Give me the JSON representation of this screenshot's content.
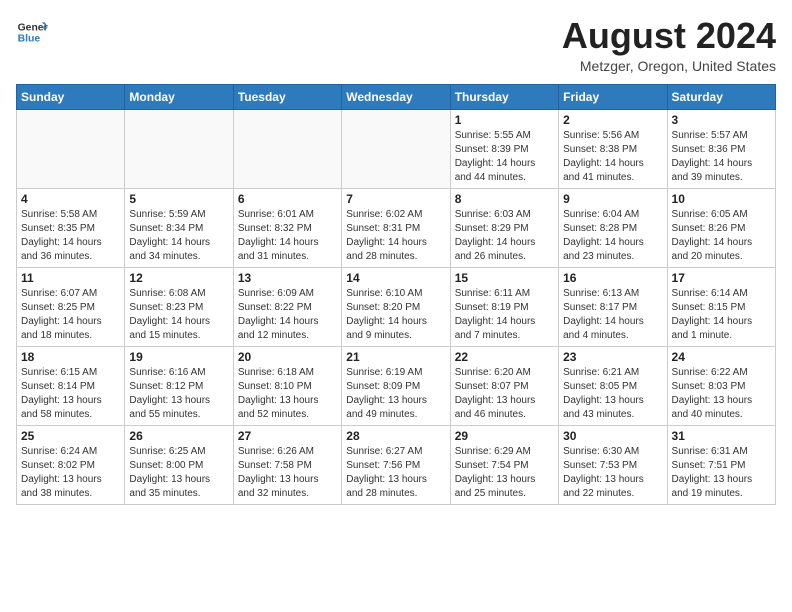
{
  "header": {
    "logo_line1": "General",
    "logo_line2": "Blue",
    "title": "August 2024",
    "subtitle": "Metzger, Oregon, United States"
  },
  "weekdays": [
    "Sunday",
    "Monday",
    "Tuesday",
    "Wednesday",
    "Thursday",
    "Friday",
    "Saturday"
  ],
  "weeks": [
    [
      {
        "day": "",
        "info": ""
      },
      {
        "day": "",
        "info": ""
      },
      {
        "day": "",
        "info": ""
      },
      {
        "day": "",
        "info": ""
      },
      {
        "day": "1",
        "info": "Sunrise: 5:55 AM\nSunset: 8:39 PM\nDaylight: 14 hours\nand 44 minutes."
      },
      {
        "day": "2",
        "info": "Sunrise: 5:56 AM\nSunset: 8:38 PM\nDaylight: 14 hours\nand 41 minutes."
      },
      {
        "day": "3",
        "info": "Sunrise: 5:57 AM\nSunset: 8:36 PM\nDaylight: 14 hours\nand 39 minutes."
      }
    ],
    [
      {
        "day": "4",
        "info": "Sunrise: 5:58 AM\nSunset: 8:35 PM\nDaylight: 14 hours\nand 36 minutes."
      },
      {
        "day": "5",
        "info": "Sunrise: 5:59 AM\nSunset: 8:34 PM\nDaylight: 14 hours\nand 34 minutes."
      },
      {
        "day": "6",
        "info": "Sunrise: 6:01 AM\nSunset: 8:32 PM\nDaylight: 14 hours\nand 31 minutes."
      },
      {
        "day": "7",
        "info": "Sunrise: 6:02 AM\nSunset: 8:31 PM\nDaylight: 14 hours\nand 28 minutes."
      },
      {
        "day": "8",
        "info": "Sunrise: 6:03 AM\nSunset: 8:29 PM\nDaylight: 14 hours\nand 26 minutes."
      },
      {
        "day": "9",
        "info": "Sunrise: 6:04 AM\nSunset: 8:28 PM\nDaylight: 14 hours\nand 23 minutes."
      },
      {
        "day": "10",
        "info": "Sunrise: 6:05 AM\nSunset: 8:26 PM\nDaylight: 14 hours\nand 20 minutes."
      }
    ],
    [
      {
        "day": "11",
        "info": "Sunrise: 6:07 AM\nSunset: 8:25 PM\nDaylight: 14 hours\nand 18 minutes."
      },
      {
        "day": "12",
        "info": "Sunrise: 6:08 AM\nSunset: 8:23 PM\nDaylight: 14 hours\nand 15 minutes."
      },
      {
        "day": "13",
        "info": "Sunrise: 6:09 AM\nSunset: 8:22 PM\nDaylight: 14 hours\nand 12 minutes."
      },
      {
        "day": "14",
        "info": "Sunrise: 6:10 AM\nSunset: 8:20 PM\nDaylight: 14 hours\nand 9 minutes."
      },
      {
        "day": "15",
        "info": "Sunrise: 6:11 AM\nSunset: 8:19 PM\nDaylight: 14 hours\nand 7 minutes."
      },
      {
        "day": "16",
        "info": "Sunrise: 6:13 AM\nSunset: 8:17 PM\nDaylight: 14 hours\nand 4 minutes."
      },
      {
        "day": "17",
        "info": "Sunrise: 6:14 AM\nSunset: 8:15 PM\nDaylight: 14 hours\nand 1 minute."
      }
    ],
    [
      {
        "day": "18",
        "info": "Sunrise: 6:15 AM\nSunset: 8:14 PM\nDaylight: 13 hours\nand 58 minutes."
      },
      {
        "day": "19",
        "info": "Sunrise: 6:16 AM\nSunset: 8:12 PM\nDaylight: 13 hours\nand 55 minutes."
      },
      {
        "day": "20",
        "info": "Sunrise: 6:18 AM\nSunset: 8:10 PM\nDaylight: 13 hours\nand 52 minutes."
      },
      {
        "day": "21",
        "info": "Sunrise: 6:19 AM\nSunset: 8:09 PM\nDaylight: 13 hours\nand 49 minutes."
      },
      {
        "day": "22",
        "info": "Sunrise: 6:20 AM\nSunset: 8:07 PM\nDaylight: 13 hours\nand 46 minutes."
      },
      {
        "day": "23",
        "info": "Sunrise: 6:21 AM\nSunset: 8:05 PM\nDaylight: 13 hours\nand 43 minutes."
      },
      {
        "day": "24",
        "info": "Sunrise: 6:22 AM\nSunset: 8:03 PM\nDaylight: 13 hours\nand 40 minutes."
      }
    ],
    [
      {
        "day": "25",
        "info": "Sunrise: 6:24 AM\nSunset: 8:02 PM\nDaylight: 13 hours\nand 38 minutes."
      },
      {
        "day": "26",
        "info": "Sunrise: 6:25 AM\nSunset: 8:00 PM\nDaylight: 13 hours\nand 35 minutes."
      },
      {
        "day": "27",
        "info": "Sunrise: 6:26 AM\nSunset: 7:58 PM\nDaylight: 13 hours\nand 32 minutes."
      },
      {
        "day": "28",
        "info": "Sunrise: 6:27 AM\nSunset: 7:56 PM\nDaylight: 13 hours\nand 28 minutes."
      },
      {
        "day": "29",
        "info": "Sunrise: 6:29 AM\nSunset: 7:54 PM\nDaylight: 13 hours\nand 25 minutes."
      },
      {
        "day": "30",
        "info": "Sunrise: 6:30 AM\nSunset: 7:53 PM\nDaylight: 13 hours\nand 22 minutes."
      },
      {
        "day": "31",
        "info": "Sunrise: 6:31 AM\nSunset: 7:51 PM\nDaylight: 13 hours\nand 19 minutes."
      }
    ]
  ]
}
